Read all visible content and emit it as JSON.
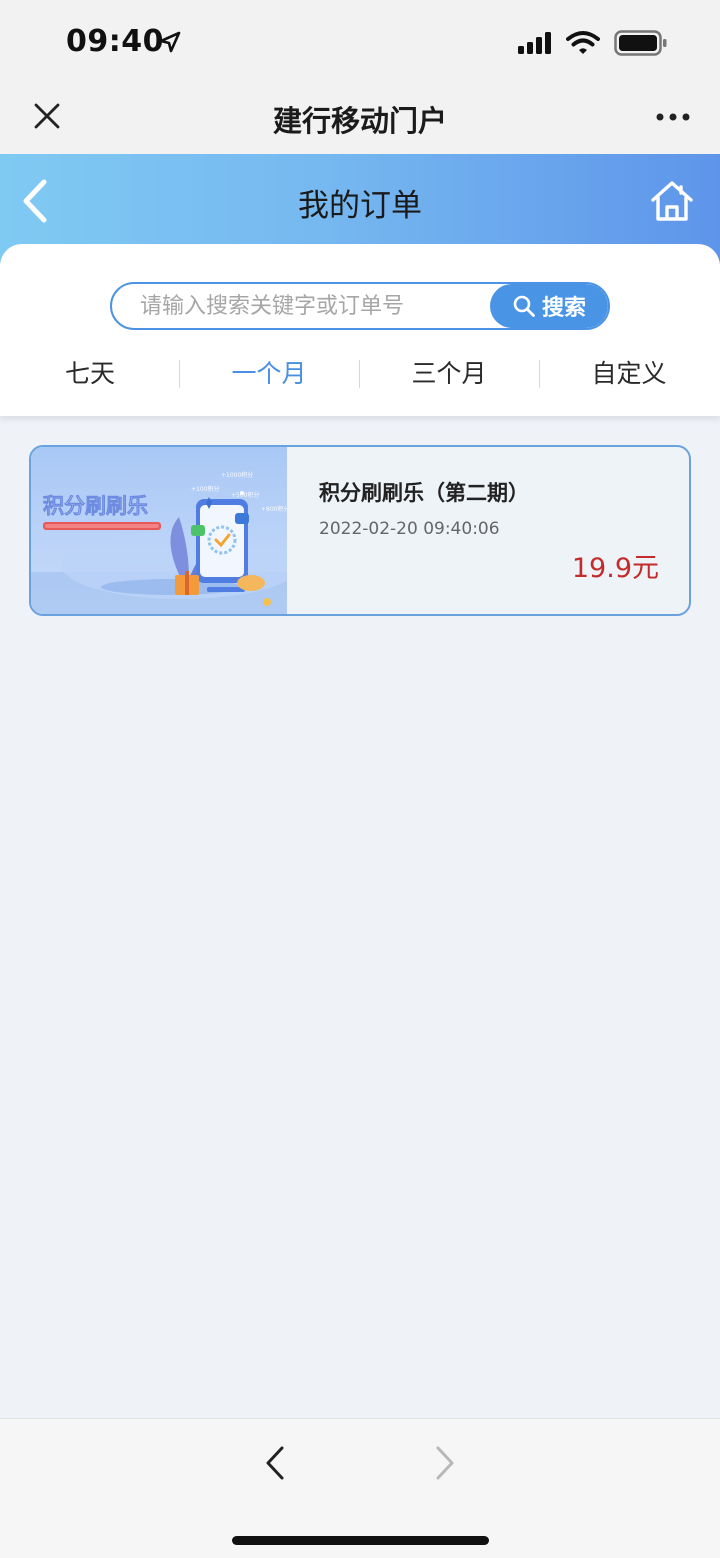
{
  "status_bar": {
    "time": "09:40"
  },
  "title_bar": {
    "title": "建行移动门户"
  },
  "header": {
    "title": "我的订单"
  },
  "search": {
    "placeholder": "请输入搜索关键字或订单号",
    "button_label": "搜索"
  },
  "tabs": [
    {
      "label": "七天",
      "active": false
    },
    {
      "label": "一个月",
      "active": true
    },
    {
      "label": "三个月",
      "active": false
    },
    {
      "label": "自定义",
      "active": false
    }
  ],
  "orders": [
    {
      "thumbnail_text": "积分刷刷乐",
      "name": "积分刷刷乐（第二期）",
      "time": "2022-02-20 09:40:06",
      "price": "19.9元"
    }
  ],
  "colors": {
    "accent": "#4a90e2",
    "price": "#c42b2b",
    "header_start": "#7fcaf3",
    "header_end": "#5e95ea"
  }
}
